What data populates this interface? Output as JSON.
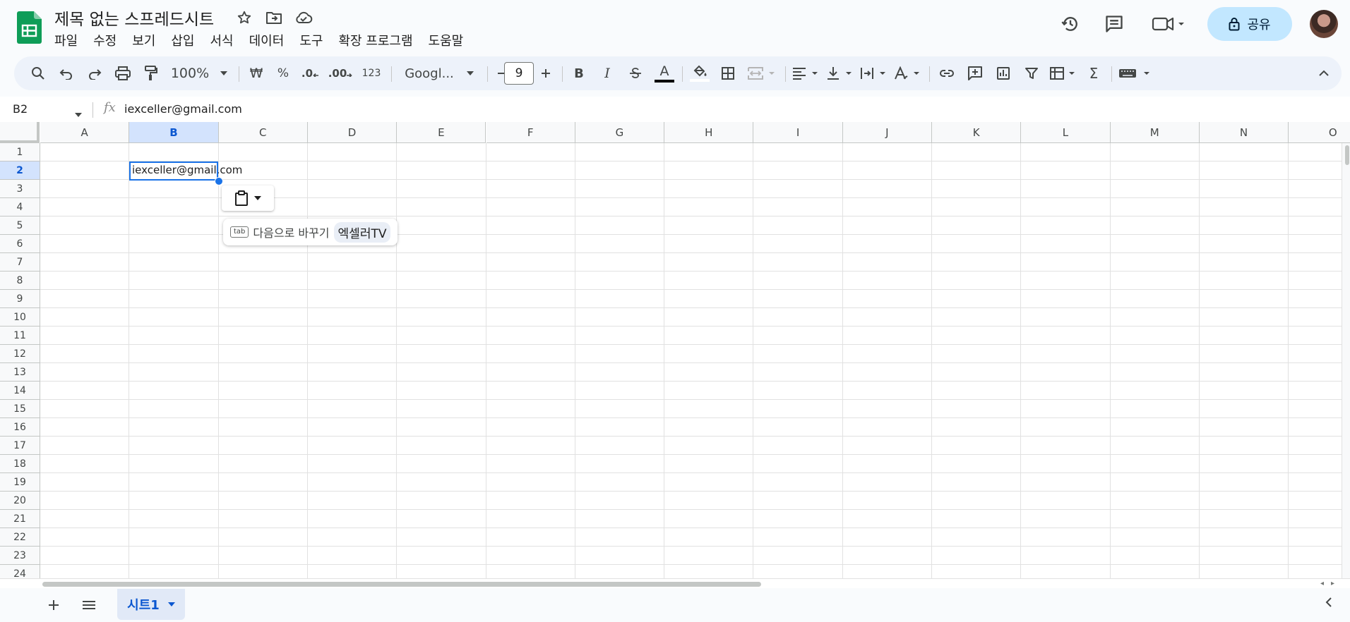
{
  "document": {
    "title": "제목 없는 스프레드시트"
  },
  "menu": [
    "파일",
    "수정",
    "보기",
    "삽입",
    "서식",
    "데이터",
    "도구",
    "확장 프로그램",
    "도움말"
  ],
  "header": {
    "share_label": "공유"
  },
  "toolbar": {
    "zoom": "100%",
    "currency": "₩",
    "percent": "%",
    "decrease_decimal": ".0",
    "increase_decimal": ".00",
    "number_format": "123",
    "font": "Googl...",
    "font_size": "9",
    "bold": "B",
    "italic": "I",
    "text_color_glyph": "A",
    "sum": "Σ"
  },
  "formula_bar": {
    "name_box": "B2",
    "fx": "fx",
    "value": "iexceller@gmail.com"
  },
  "columns": [
    "A",
    "B",
    "C",
    "D",
    "E",
    "F",
    "G",
    "H",
    "I",
    "J",
    "K",
    "L",
    "M",
    "N",
    "O"
  ],
  "rows": [
    "1",
    "2",
    "3",
    "4",
    "5",
    "6",
    "7",
    "8",
    "9",
    "10",
    "11",
    "12",
    "13",
    "14",
    "15",
    "16",
    "17",
    "18",
    "19",
    "20",
    "21",
    "22",
    "23",
    "24"
  ],
  "selected_cell": {
    "col": "B",
    "row": "2",
    "value": "iexceller@gmail.com"
  },
  "smart_fill": {
    "key": "tab",
    "label": "다음으로 바꾸기",
    "suggestion": "엑셀러TV"
  },
  "sheets": [
    {
      "name": "시트1",
      "active": true
    }
  ],
  "colors": {
    "accent": "#0b57d0",
    "selection": "#1a73e8",
    "share_bg": "#c2e7ff",
    "toolbar_bg": "#edf2fa"
  }
}
